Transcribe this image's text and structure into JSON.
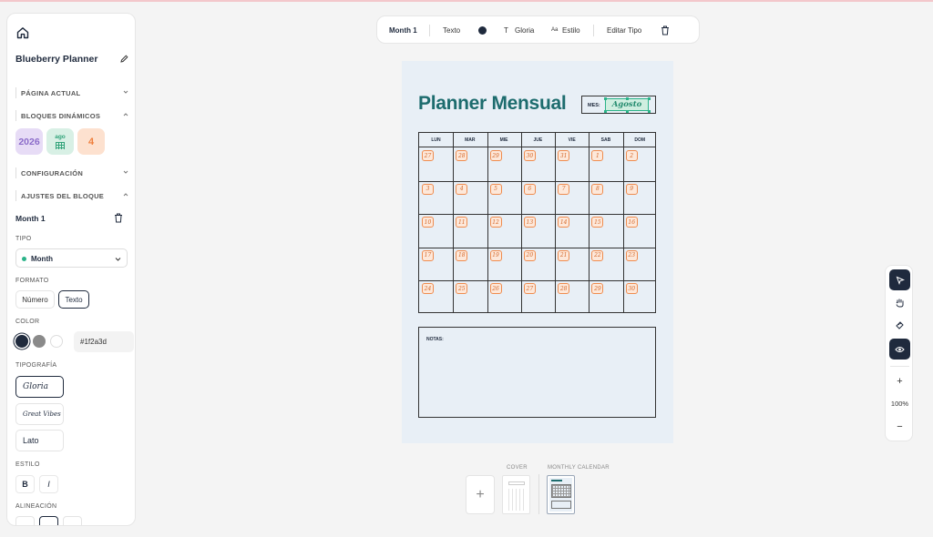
{
  "project": {
    "title": "Blueberry Planner"
  },
  "sidebar": {
    "sections": {
      "current_page": "PÁGINA ACTUAL",
      "dynamic_blocks": "BLOQUES DINÁMICOS",
      "config": "CONFIGURACIÓN",
      "block_settings": "AJUSTES DEL BLOQUE"
    },
    "chips": {
      "year": "2026",
      "month": "ago",
      "day": "4"
    },
    "block": {
      "title": "Month 1"
    },
    "tipo": {
      "label": "TIPO",
      "value": "Month"
    },
    "formato": {
      "label": "FORMATO",
      "options": [
        "Número",
        "Texto"
      ],
      "selected": "Texto"
    },
    "color": {
      "label": "COLOR",
      "hex": "#1f2a3d",
      "swatches": [
        "#1f2a3d",
        "#8a8a8a",
        "#ffffff"
      ]
    },
    "tipografia": {
      "label": "TIPOGRAFÍA",
      "fonts": [
        "Gloria",
        "Great Vibes",
        "Lato"
      ],
      "selected": "Gloria"
    },
    "estilo": {
      "label": "ESTILO",
      "bold": "B",
      "italic": "I"
    },
    "alineacion": {
      "label": "ALINEACIÓN"
    }
  },
  "toolbar": {
    "block_name": "Month 1",
    "texto": "Texto",
    "color": "#1f2a3d",
    "font": "Gloria",
    "font_prefix": "T",
    "estilo_prefix": "Aa",
    "estilo": "Estilo",
    "editar_tipo": "Editar Tipo"
  },
  "page": {
    "title": "Planner Mensual",
    "mes_label": "MES:",
    "mes_value": "Agosto",
    "weekdays": [
      "LUN",
      "MAR",
      "MIE",
      "JUE",
      "VIE",
      "SAB",
      "DOM"
    ],
    "days": [
      [
        "27",
        "28",
        "29",
        "30",
        "31",
        "1",
        "2"
      ],
      [
        "3",
        "4",
        "5",
        "6",
        "7",
        "8",
        "9"
      ],
      [
        "10",
        "11",
        "12",
        "13",
        "14",
        "15",
        "16"
      ],
      [
        "17",
        "18",
        "19",
        "20",
        "21",
        "22",
        "23"
      ],
      [
        "24",
        "25",
        "26",
        "27",
        "28",
        "29",
        "30"
      ]
    ],
    "notes_label": "NOTAS:"
  },
  "tools": {
    "zoom": "100%",
    "plus": "+",
    "minus": "−"
  },
  "pages": {
    "add": "+",
    "cover": "COVER",
    "monthly": "MONTHLY CALENDAR"
  }
}
